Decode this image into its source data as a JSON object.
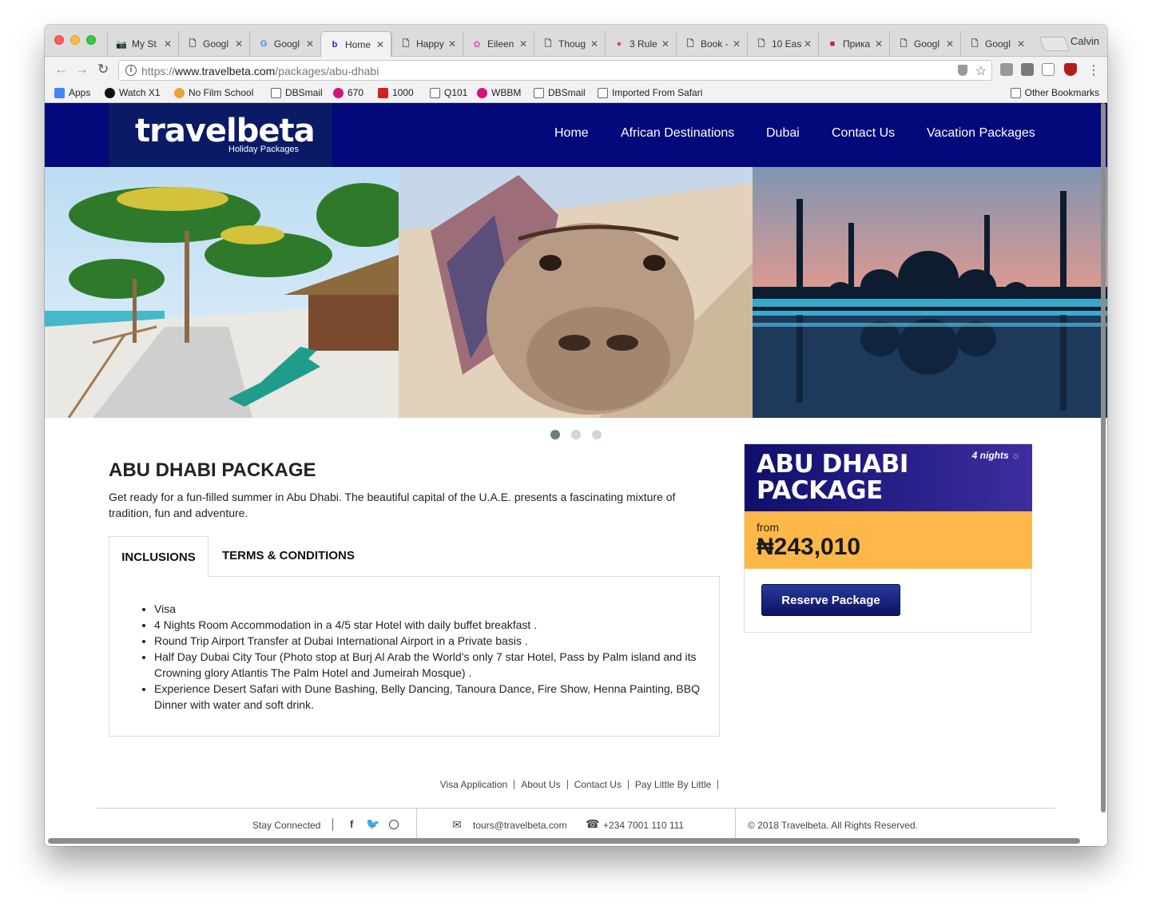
{
  "browser": {
    "profile_name": "Calvin",
    "tabs": [
      {
        "title": "My St",
        "icon": "camera-icon"
      },
      {
        "title": "Googl",
        "icon": "page-icon"
      },
      {
        "title": "Googl",
        "icon": "google-icon"
      },
      {
        "title": "Home",
        "icon": "travelbeta-icon",
        "active": true
      },
      {
        "title": "Happy",
        "icon": "page-icon"
      },
      {
        "title": "Eileen",
        "icon": "flower-icon"
      },
      {
        "title": "Thoug",
        "icon": "page-icon"
      },
      {
        "title": "3 Rule",
        "icon": "red-circle-icon"
      },
      {
        "title": "Book -",
        "icon": "page-icon"
      },
      {
        "title": "10 Eas",
        "icon": "page-icon"
      },
      {
        "title": "Прика",
        "icon": "red-square-icon"
      },
      {
        "title": "Googl",
        "icon": "page-icon"
      },
      {
        "title": "Googl",
        "icon": "page-icon"
      }
    ],
    "url_prefix": "https://",
    "url_domain": "www.travelbeta.com",
    "url_path": "/packages/abu-dhabi",
    "bookmarks": [
      {
        "label": "Apps",
        "icon": "apps-grid-icon"
      },
      {
        "label": "Watch X1",
        "icon": "play-icon"
      },
      {
        "label": "No Film School",
        "icon": "colorwheel-icon"
      },
      {
        "label": "DBSmail",
        "icon": "google-icon"
      },
      {
        "label": "670",
        "icon": "play-pink-icon"
      },
      {
        "label": "1000",
        "icon": "espn-icon"
      },
      {
        "label": "Q101",
        "icon": "page-icon"
      },
      {
        "label": "WBBM",
        "icon": "play-pink-icon"
      },
      {
        "label": "DBSmail",
        "icon": "google-icon"
      },
      {
        "label": "Imported From Safari",
        "icon": "folder-icon"
      }
    ],
    "other_bookmarks": "Other Bookmarks"
  },
  "site": {
    "logo_text": "travelbeta",
    "logo_sub": "Holiday Packages",
    "nav": [
      "Home",
      "African Destinations",
      "Dubai",
      "Contact Us",
      "Vacation Packages"
    ],
    "slider_dots": 3,
    "slider_active": 0
  },
  "package": {
    "title": "ABU DHABI PACKAGE",
    "description": "Get ready for a fun-filled summer in Abu Dhabi. The beautiful capital of the U.A.E. presents a fascinating mixture of tradition, fun and adventure.",
    "tab_inclusions": "INCLUSIONS",
    "tab_terms": "TERMS & CONDITIONS",
    "inclusions": [
      "Visa",
      "4 Nights Room Accommodation in a 4/5 star Hotel with daily buffet breakfast .",
      "Round Trip Airport Transfer at Dubai International Airport in a Private basis .",
      "Half Day Dubai City Tour (Photo stop at Burj Al Arab the World’s only 7 star Hotel, Pass by Palm island and its Crowning glory Atlantis The Palm Hotel and Jumeirah Mosque) .",
      "Experience Desert Safari with Dune Bashing, Belly Dancing, Tanoura Dance, Fire Show, Henna Painting, BBQ Dinner with water and soft drink."
    ]
  },
  "card": {
    "title": "ABU DHABI PACKAGE",
    "nights": "4 nights",
    "from_label": "from",
    "price": "₦243,010",
    "reserve_label": "Reserve Package"
  },
  "footer": {
    "links": [
      "Visa Application",
      "About Us",
      "Contact Us",
      "Pay Little By Little"
    ],
    "stay_connected": "Stay Connected",
    "email": "tours@travelbeta.com",
    "phone": "+234 7001 110 111",
    "copyright": "© 2018 Travelbeta. All Rights Reserved."
  }
}
